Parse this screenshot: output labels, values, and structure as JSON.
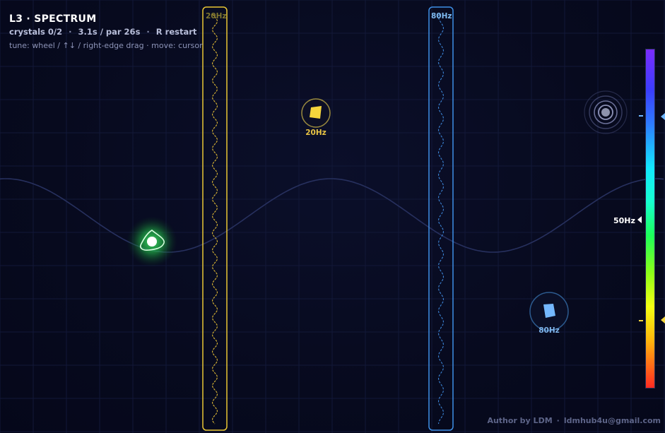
{
  "hud": {
    "title": "L3 · SPECTRUM",
    "crystals": "crystals 0/2",
    "sep": "·",
    "timer": "3.1s / par 26s",
    "restart": "R restart",
    "help": "tune: wheel / ↑↓ / right-edge drag · move: cursor"
  },
  "gates": [
    {
      "label": "20Hz",
      "color": "#f2cf3a",
      "label_color": "#7e7530"
    },
    {
      "label": "80Hz",
      "color": "#4a9ff5",
      "label_color": "#7fbaf0"
    }
  ],
  "crystals": [
    {
      "label": "20Hz",
      "color": "#f5d63c",
      "label_color": "#e8c444"
    },
    {
      "label": "80Hz",
      "color": "#6fb6ff",
      "label_color": "#7fb4ea"
    }
  ],
  "spectrum": {
    "current_label": "50Hz",
    "current_fraction": 0.5,
    "marker_fractions": [
      0.2,
      0.8
    ]
  },
  "player": {
    "color": "#3dd862"
  },
  "exit": {
    "icon": "target-icon"
  },
  "footer": {
    "author": "Author by LDM",
    "sep": "·",
    "email": "ldmhub4u@gmail.com"
  }
}
